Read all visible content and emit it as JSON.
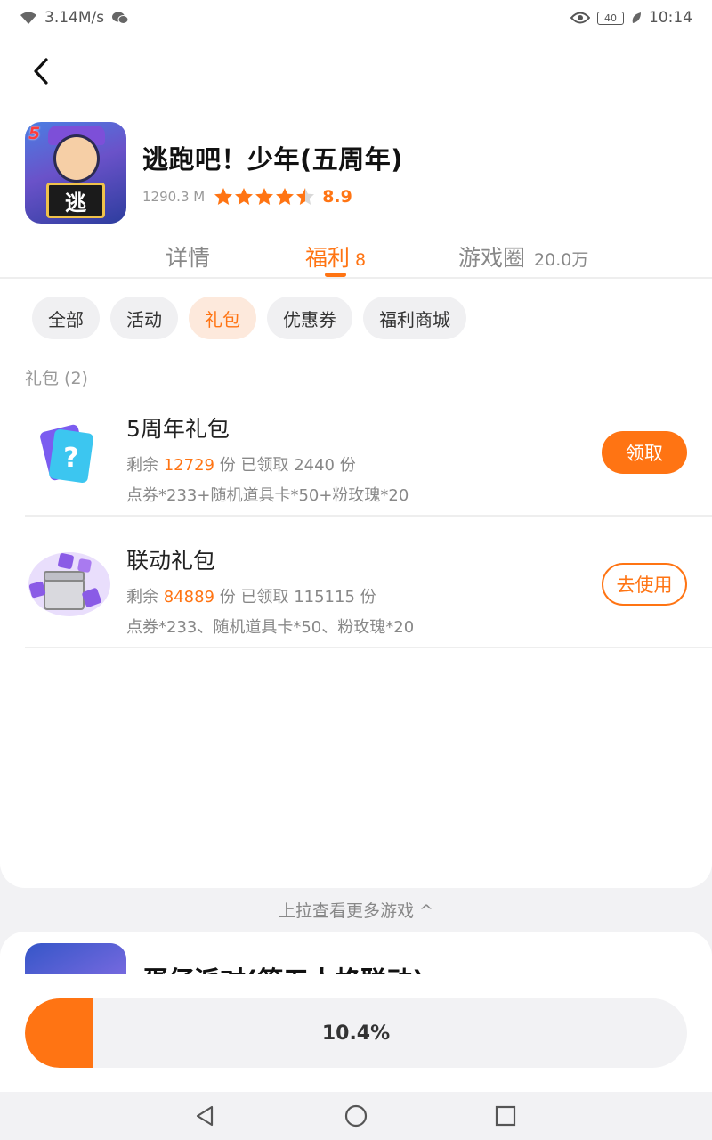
{
  "status_bar": {
    "speed": "3.14M/s",
    "battery": "40",
    "time": "10:14",
    "icons": [
      "wifi-icon",
      "wechat-icon",
      "eye-icon",
      "battery-icon",
      "leaf-icon"
    ]
  },
  "game": {
    "title": "逃跑吧！少年(五周年)",
    "size": "1290.3 M",
    "rating": "8.9",
    "rating_stars": 4.5,
    "icon_badge": "5",
    "icon_sign": "逃"
  },
  "tabs": [
    {
      "label": "详情",
      "count": ""
    },
    {
      "label": "福利",
      "count": "8"
    },
    {
      "label": "游戏圈",
      "count": "20.0万"
    }
  ],
  "chips": [
    "全部",
    "活动",
    "礼包",
    "优惠券",
    "福利商城"
  ],
  "section_title": "礼包 (2)",
  "gifts": [
    {
      "name": "5周年礼包",
      "remain_label": "剩余",
      "remain": "12729",
      "unit": "份",
      "claimed_label": "已领取",
      "claimed": "2440",
      "claimed_unit": "份",
      "desc": "点券*233+随机道具卡*50+粉玫瑰*20",
      "button": "领取"
    },
    {
      "name": "联动礼包",
      "remain_label": "剩余",
      "remain": "84889",
      "unit": "份",
      "claimed_label": "已领取",
      "claimed": "115115",
      "claimed_unit": "份",
      "desc": "点券*233、随机道具卡*50、粉玫瑰*20",
      "button": "去使用"
    }
  ],
  "more_hint": "上拉查看更多游戏 ^",
  "next_game": {
    "title": "蛋仔派对(第五人格联动)"
  },
  "download": {
    "progress": 0.104,
    "label": "10.4%"
  },
  "colors": {
    "accent": "#ff7413",
    "accent_light": "#fde9dc"
  }
}
